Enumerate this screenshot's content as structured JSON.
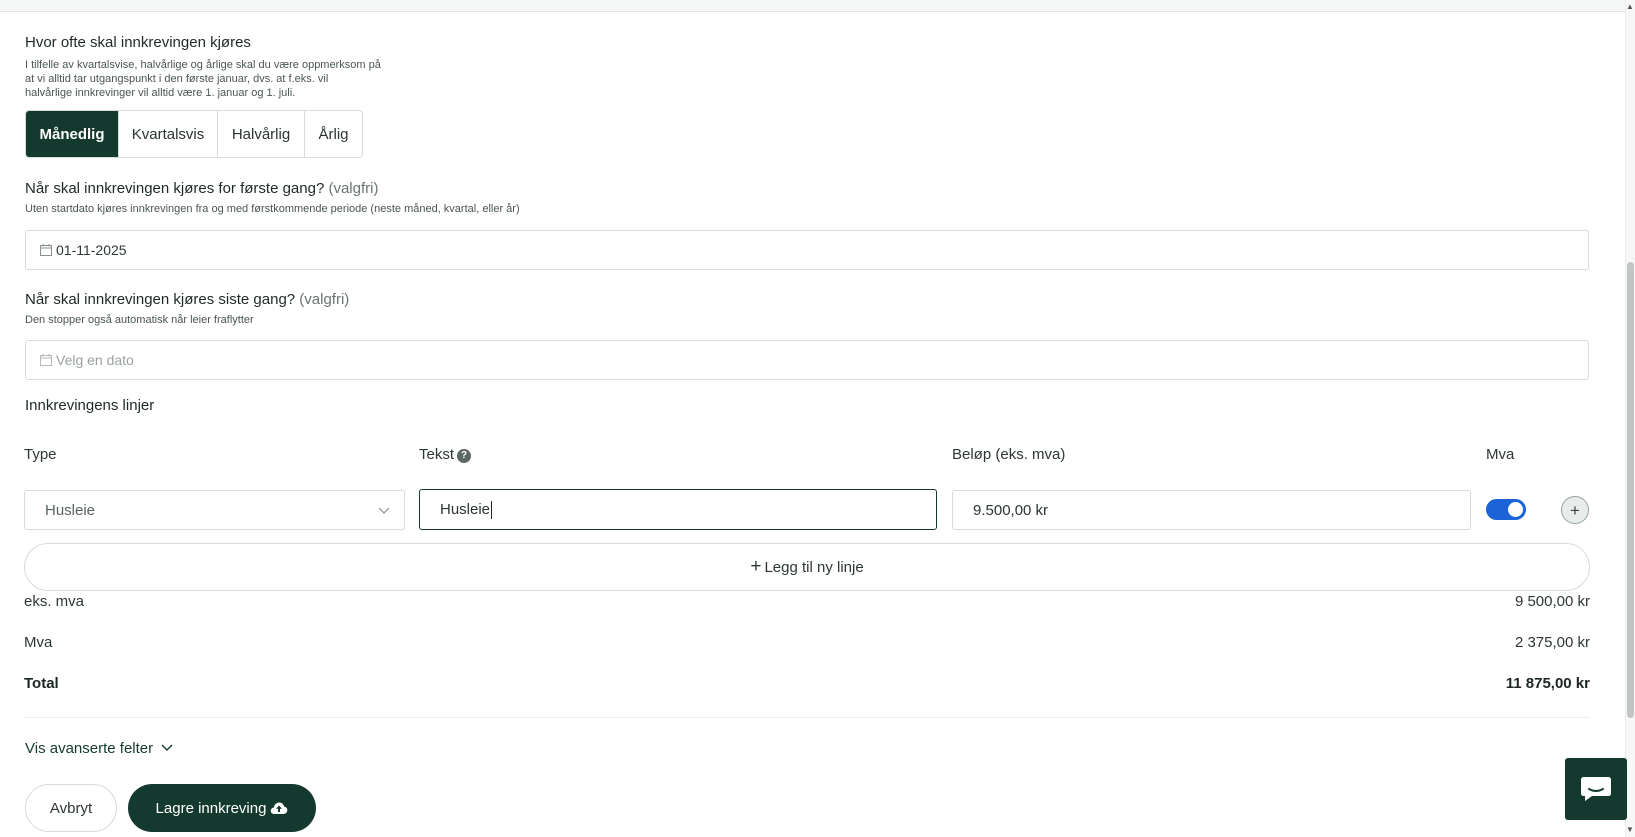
{
  "frequency": {
    "title": "Hvor ofte skal innkrevingen kjøres",
    "help_lines": [
      "I tilfelle av kvartalsvise, halvårlige og årlige skal du være oppmerksom på",
      "at vi alltid tar utgangspunkt i den første januar, dvs. at f.eks. vil",
      "halvårlige innkrevinger vil alltid være 1. januar og 1. juli."
    ],
    "options": [
      "Månedlig",
      "Kvartalsvis",
      "Halvårlig",
      "Årlig"
    ],
    "selected": "Månedlig"
  },
  "first_run": {
    "title": "Når skal innkrevingen kjøres for første gang?",
    "optional": "(valgfri)",
    "help": "Uten startdato kjøres innkrevingen fra og med førstkommende periode (neste måned, kvartal, eller år)",
    "value": "01-11-2025"
  },
  "last_run": {
    "title": "Når skal innkrevingen kjøres siste gang?",
    "optional": "(valgfri)",
    "help": "Den stopper også automatisk når leier fraflytter",
    "placeholder": "Velg en dato"
  },
  "lines": {
    "title": "Innkrevingens linjer",
    "headers": {
      "type": "Type",
      "text": "Tekst",
      "amount": "Beløp (eks. mva)",
      "vat": "Mva"
    },
    "row": {
      "type": "Husleie",
      "text": "Husleie",
      "amount": "9.500,00 kr",
      "vat_enabled": true
    },
    "add_label": "Legg til ny linje"
  },
  "summary": {
    "ex_vat_label": "eks. mva",
    "ex_vat_amount": "9 500,00 kr",
    "vat_label": "Mva",
    "vat_amount": "2 375,00 kr",
    "total_label": "Total",
    "total_amount": "11 875,00 kr"
  },
  "advanced_label": "Vis avanserte felter",
  "actions": {
    "cancel": "Avbryt",
    "save": "Lagre innkreving"
  },
  "colors": {
    "primary": "#143a2f",
    "toggle": "#1b63d6",
    "border": "#d7dbda"
  },
  "icons": {
    "calendar": "calendar-icon",
    "chevron": "chevron-down-icon",
    "help": "question-icon",
    "plus": "plus-icon",
    "upload": "cloud-upload-icon",
    "chat": "chat-icon"
  }
}
